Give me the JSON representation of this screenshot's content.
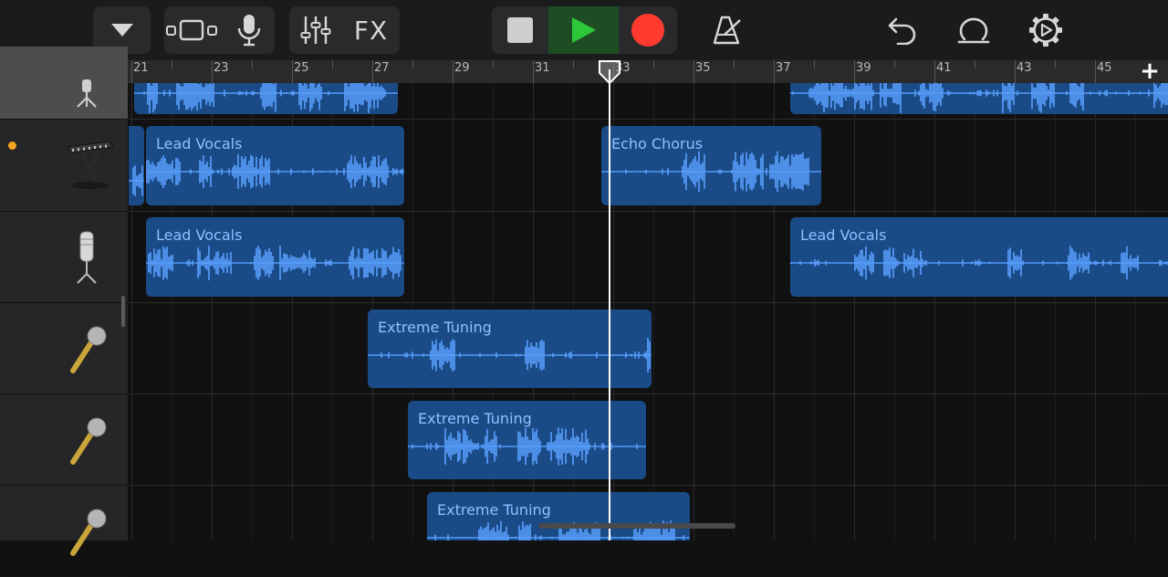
{
  "toolbar": {
    "buttons": [
      {
        "name": "browser-menu-button",
        "icon": "triangle-down-icon"
      },
      {
        "name": "tracks-view-button",
        "icon": "tracks-view-icon"
      },
      {
        "name": "microphone-button",
        "icon": "microphone-icon"
      },
      {
        "name": "mixer-button",
        "icon": "sliders-icon"
      },
      {
        "name": "fx-button",
        "label": "FX"
      },
      {
        "name": "stop-button",
        "icon": "stop-icon"
      },
      {
        "name": "play-button",
        "icon": "play-icon"
      },
      {
        "name": "record-button",
        "icon": "record-icon"
      },
      {
        "name": "metronome-button",
        "icon": "metronome-icon"
      },
      {
        "name": "undo-button",
        "icon": "undo-icon"
      },
      {
        "name": "loop-browser-button",
        "icon": "loop-icon"
      },
      {
        "name": "settings-button",
        "icon": "gear-icon"
      }
    ],
    "fx_label": "FX",
    "colors": {
      "play": "#2ec73a",
      "record": "#ff3b30",
      "play_bg": "#1f4d23"
    }
  },
  "ruler": {
    "bar_numbers": [
      "21",
      "23",
      "25",
      "27",
      "29",
      "31",
      "33",
      "35",
      "37",
      "39",
      "41",
      "43",
      "45"
    ],
    "add_track_label": "+"
  },
  "tracks": [
    {
      "instrument_icon": "microphone-condenser-icon",
      "selected": true,
      "regions": [
        {
          "title": ""
        },
        {
          "title": ""
        }
      ]
    },
    {
      "instrument_icon": "keyboard-icon",
      "indicator": true,
      "regions": [
        {
          "title": ""
        },
        {
          "title": "Lead Vocals"
        },
        {
          "title": "Echo Chorus"
        }
      ]
    },
    {
      "instrument_icon": "microphone-condenser-icon",
      "regions": [
        {
          "title": "Lead Vocals"
        },
        {
          "title": "Lead Vocals"
        }
      ]
    },
    {
      "instrument_icon": "microphone-handheld-icon",
      "regions": [
        {
          "title": "Extreme Tuning"
        }
      ]
    },
    {
      "instrument_icon": "microphone-handheld-icon",
      "regions": [
        {
          "title": "Extreme Tuning"
        }
      ]
    },
    {
      "instrument_icon": "microphone-handheld-icon",
      "regions": [
        {
          "title": "Extreme Tuning"
        }
      ]
    }
  ],
  "colors": {
    "region": "#1a4b87",
    "waveform": "#5aa0ff",
    "region_text": "#8fc0ff",
    "indicator": "#f5a623"
  }
}
